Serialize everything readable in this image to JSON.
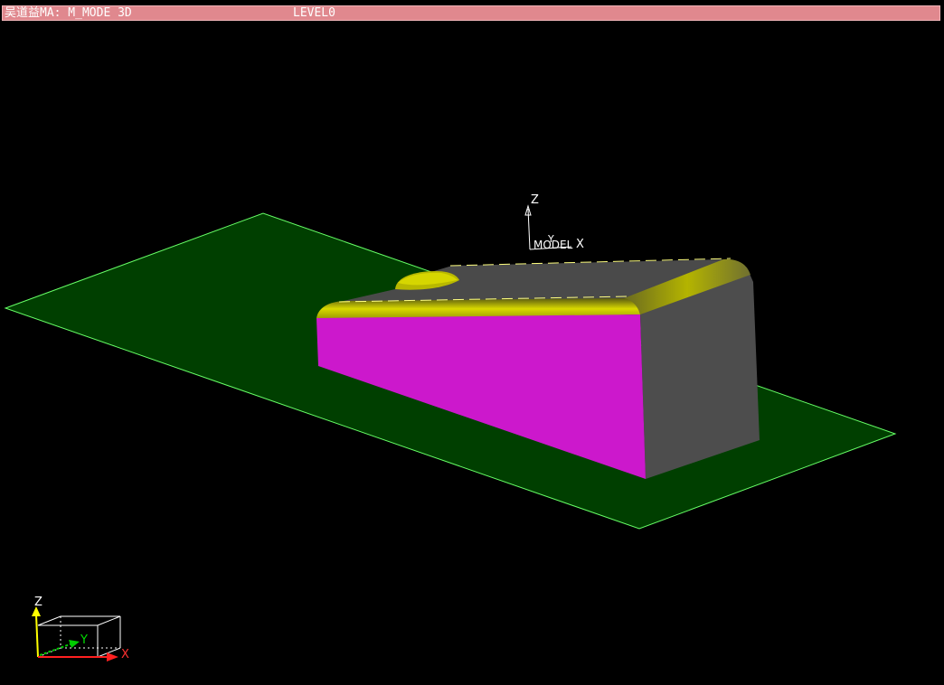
{
  "window": {
    "title": "吴道益MA: M_MODE 3D",
    "level": "LEVEL0"
  },
  "scene": {
    "model_axis": {
      "z_label": "Z",
      "y_label": "Y",
      "x_label": "X",
      "model_label": "MODEL"
    },
    "view_triad": {
      "z_label": "Z",
      "y_label": "Y",
      "x_label": "X"
    }
  },
  "colors": {
    "background": "#000000",
    "title_bar": "#e0888e",
    "ground_plane": "#003f00",
    "ground_edge": "#66ff66",
    "top_face": "#4a4a4a",
    "fillet_edge": "#c8c800",
    "front_face": "#cc18cc",
    "end_face": "#4d4d4d",
    "axis_z": "#ffff00",
    "axis_y": "#00cc00",
    "axis_x": "#ff2020"
  }
}
